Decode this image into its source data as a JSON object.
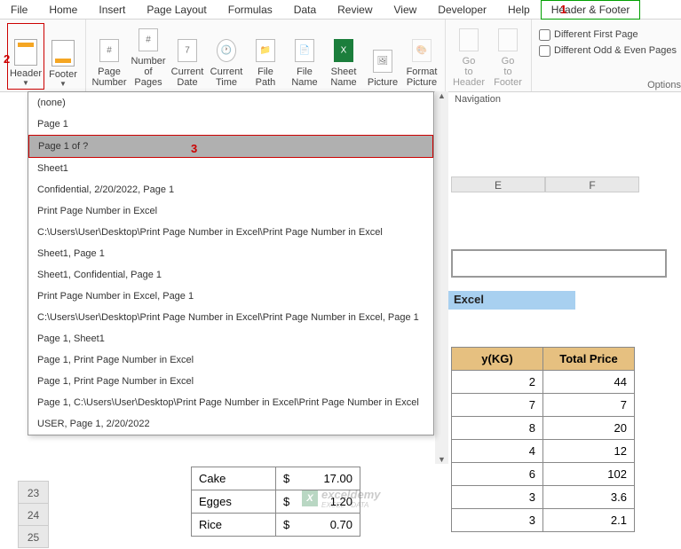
{
  "menu": [
    "File",
    "Home",
    "Insert",
    "Page Layout",
    "Formulas",
    "Data",
    "Review",
    "View",
    "Developer",
    "Help",
    "Header & Footer"
  ],
  "activeMenu": 10,
  "ribbon": {
    "headerFooter": {
      "header": "Header",
      "footer": "Footer"
    },
    "elements": [
      "Page Number",
      "Number of Pages",
      "Current Date",
      "Current Time",
      "File Path",
      "File Name",
      "Sheet Name",
      "Picture",
      "Format Picture"
    ],
    "navigation": [
      "Go to Header",
      "Go to Footer"
    ],
    "options": {
      "diffFirst": "Different First Page",
      "diffOdd": "Different Odd & Even Pages",
      "optionsLabel": "Options"
    }
  },
  "ann": {
    "a1": "1",
    "a2": "2",
    "a3": "3"
  },
  "nav": "Navigation",
  "dropdown": [
    "(none)",
    "Page 1",
    "Page 1 of ?",
    "Sheet1",
    " Confidential, 2/20/2022, Page 1",
    "Print Page Number in Excel",
    "C:\\Users\\User\\Desktop\\Print Page Number in Excel\\Print Page Number in Excel",
    "Sheet1, Page 1",
    "Sheet1,  Confidential, Page 1",
    "Print Page Number in Excel, Page 1",
    "C:\\Users\\User\\Desktop\\Print Page Number in Excel\\Print Page Number in Excel, Page 1",
    "Page 1, Sheet1",
    "Page 1, Print Page Number in Excel",
    "Page 1, Print Page Number in Excel",
    "Page 1, C:\\Users\\User\\Desktop\\Print Page Number in Excel\\Print Page Number in Excel",
    "USER, Page 1, 2/20/2022"
  ],
  "hlIndex": 2,
  "cols": [
    "E",
    "F"
  ],
  "blueCell": "Excel",
  "table": {
    "headers": [
      "",
      "",
      "y(KG)",
      "Total Price"
    ],
    "rows": [
      {
        "item": "",
        "price": "",
        "qty": "2",
        "total": "44"
      },
      {
        "item": "",
        "price": "",
        "qty": "7",
        "total": "7"
      },
      {
        "item": "",
        "price": "",
        "qty": "8",
        "total": "20"
      },
      {
        "item": "",
        "price": "",
        "qty": "4",
        "total": "12"
      },
      {
        "item": "Cake",
        "price": "17.00",
        "qty": "6",
        "total": "102"
      },
      {
        "item": "Egges",
        "price": "1.20",
        "qty": "3",
        "total": "3.6"
      },
      {
        "item": "Rice",
        "price": "0.70",
        "qty": "3",
        "total": "2.1"
      }
    ]
  },
  "rowLabels": [
    "23",
    "24",
    "25"
  ],
  "watermark": {
    "icon": "X",
    "text1": "exceldemy",
    "text2": "EXCEL · DATA"
  }
}
